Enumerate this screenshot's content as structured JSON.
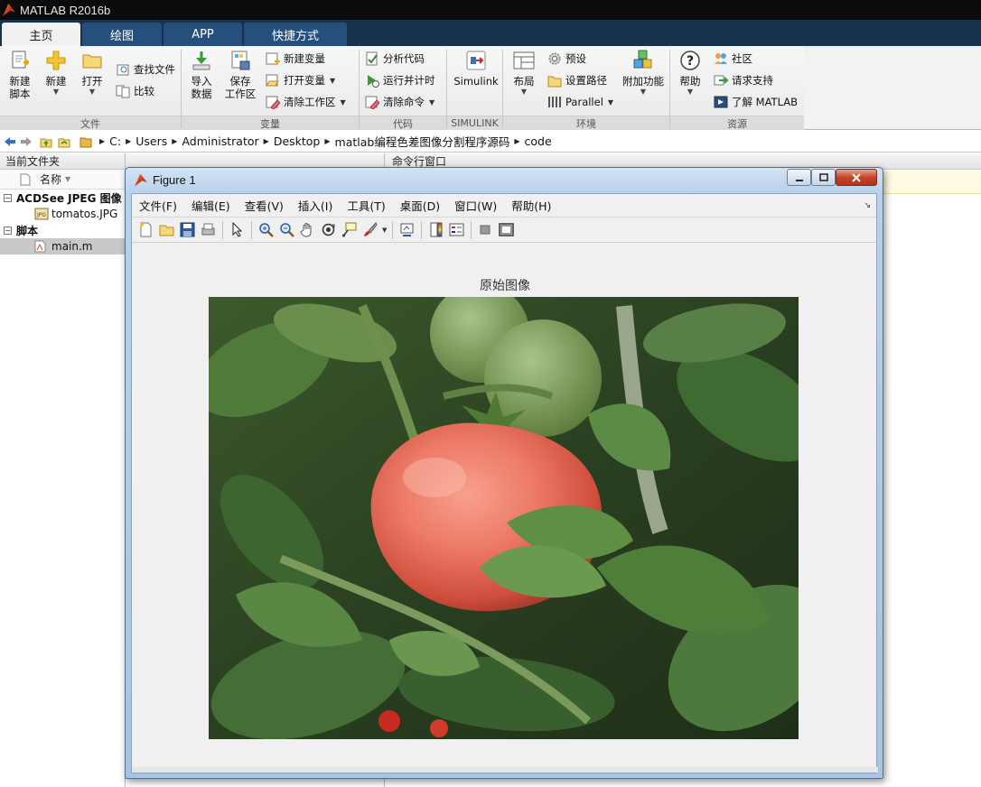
{
  "app": {
    "title": "MATLAB R2016b"
  },
  "ribbon": {
    "tabs": [
      "主页",
      "绘图",
      "APP",
      "快捷方式"
    ],
    "active_tab": "主页",
    "file": {
      "label": "文件",
      "new_script": [
        "新建",
        "脚本"
      ],
      "new": "新建",
      "open": "打开",
      "find_files": "查找文件",
      "compare": "比较"
    },
    "variable": {
      "label": "变量",
      "import_data": [
        "导入",
        "数据"
      ],
      "save_workspace": [
        "保存",
        "工作区"
      ],
      "new_variable": "新建变量",
      "open_variable": "打开变量",
      "clear_workspace": "清除工作区"
    },
    "code": {
      "label": "代码",
      "analyze_code": "分析代码",
      "run_and_time": "运行并计时",
      "clear_commands": "清除命令"
    },
    "simulink": {
      "label": "SIMULINK",
      "button": "Simulink"
    },
    "environment": {
      "label": "环境",
      "layout": "布局",
      "preferences": "预设",
      "set_path": "设置路径",
      "parallel": "Parallel",
      "addons": "附加功能"
    },
    "resources": {
      "label": "资源",
      "help": "帮助",
      "community": "社区",
      "request_support": "请求支持",
      "learn_matlab": "了解 MATLAB"
    }
  },
  "address": {
    "path": [
      "C:",
      "Users",
      "Administrator",
      "Desktop",
      "matlab编程色差图像分割程序源码",
      "code"
    ]
  },
  "current_folder": {
    "title": "当前文件夹",
    "column_name": "名称",
    "groups": [
      {
        "label": "ACDSee JPEG 图像",
        "items": [
          "tomatos.JPG"
        ]
      },
      {
        "label": "脚本",
        "items": [
          "main.m"
        ]
      }
    ]
  },
  "command_window": {
    "title": "命令行窗口"
  },
  "figure": {
    "title": "Figure 1",
    "menu": [
      "文件(F)",
      "编辑(E)",
      "查看(V)",
      "插入(I)",
      "工具(T)",
      "桌面(D)",
      "窗口(W)",
      "帮助(H)"
    ],
    "plot_title": "原始图像"
  },
  "colors": {
    "ribbon_tab_bar": "#17324f",
    "ribbon_tab": "#274f7d",
    "title_bar": "#0b0b0b",
    "tomato": "#e86a5a"
  }
}
